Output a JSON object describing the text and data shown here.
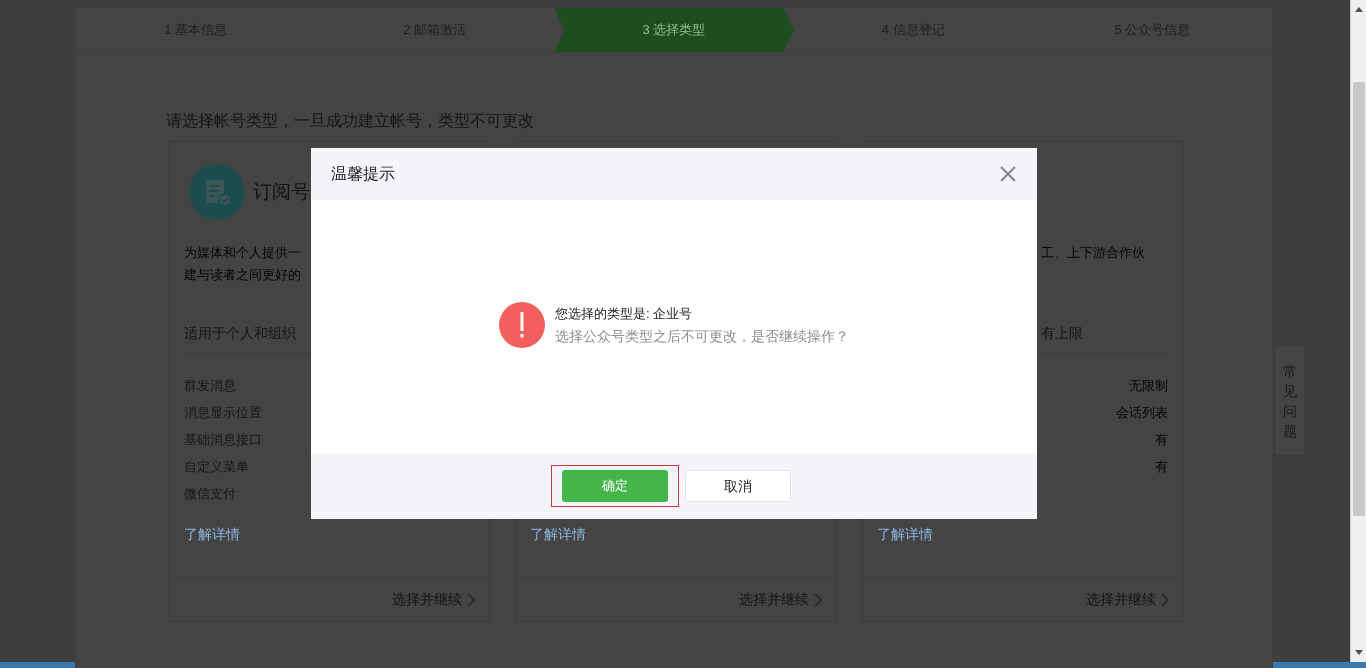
{
  "steps": [
    {
      "label": "1 基本信息",
      "selected": false
    },
    {
      "label": "2 邮箱激活",
      "selected": false
    },
    {
      "label": "3 选择类型",
      "selected": true
    },
    {
      "label": "4 信息登记",
      "selected": false
    },
    {
      "label": "5 公众号信息",
      "selected": false
    }
  ],
  "instruction": "请选择帐号类型，一旦成功建立帐号，类型不可更改",
  "cards": [
    {
      "title": "订阅号",
      "description": [
        "为媒体和个人提供一",
        "建与读者之间更好的"
      ],
      "audience": "适用于个人和组织",
      "features": [
        "群发消息",
        "消息显示位置",
        "基础消息接口",
        "自定义菜单",
        "微信支付"
      ],
      "details_link": "了解详情",
      "select_link": "选择并继续"
    },
    {
      "details_link": "了解详情",
      "select_link": "选择并继续"
    },
    {
      "description": [
        "工、上下游合作伙"
      ],
      "audience": "有上限",
      "values": [
        "无限制",
        "会话列表",
        "有",
        "有"
      ],
      "details_link": "了解详情",
      "select_link": "选择并继续"
    }
  ],
  "faq_tab": "常见问题",
  "dialog": {
    "title": "温馨提示",
    "message": "您选择的类型是: 企业号",
    "note": "选择公众号类型之后不可更改，是否继续操作？",
    "buttons": [
      {
        "label": "确定",
        "kind": "primary",
        "focused": true
      },
      {
        "label": "取消",
        "kind": "secondary",
        "focused": false
      }
    ]
  }
}
